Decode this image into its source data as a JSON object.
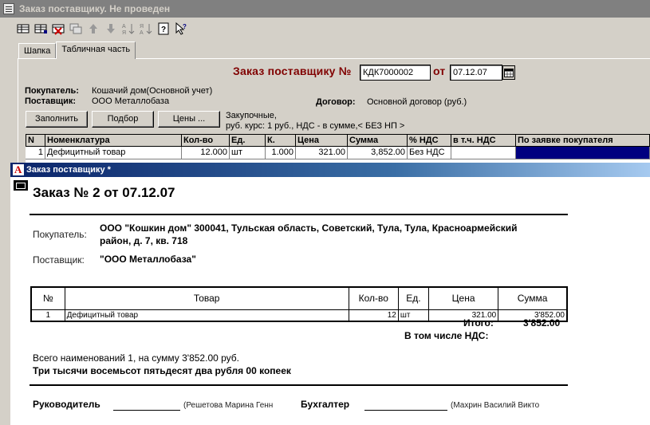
{
  "bg_window": {
    "title": "Заказ поставщику. Не проведен",
    "toolbar_icons": [
      "table-icon",
      "grid-icon",
      "delete-row-icon",
      "copy-row-icon",
      "arrow-up-icon",
      "arrow-down-icon",
      "sort-asc-icon",
      "sort-desc-icon",
      "help-icon",
      "pointer-help-icon"
    ],
    "tabs": [
      "Шапка",
      "Табличная часть"
    ],
    "active_tab": "Табличная часть",
    "heading": "Заказ поставщику №",
    "number": "КДК7000002",
    "date_label": "от",
    "date": "07.12.07",
    "buyer_label": "Покупатель:",
    "buyer_value": "Кошачий дом(Основной учет)",
    "supplier_label": "Поставщик:",
    "supplier_value": "ООО Металлобаза",
    "contract_label": "Договор:",
    "contract_value": "Основной договор (руб.)",
    "btn_fill": "Заполнить",
    "btn_select": "Подбор",
    "btn_prices": "Цены ...",
    "price_info_1": "Закупочные,",
    "price_info_2": "руб. курс: 1 руб., НДС - в сумме,< БЕЗ НП >",
    "grid_headers": [
      "N",
      "Номенклатура",
      "Кол-во",
      "Ед.",
      "К.",
      "Цена",
      "Сумма",
      "% НДС",
      "в т.ч. НДС",
      "По заявке покупателя"
    ],
    "grid_row": [
      "1",
      "Дефицитный товар",
      "12.000",
      "шт",
      "1.000",
      "321.00",
      "3,852.00",
      "Без НДС",
      "",
      ""
    ]
  },
  "fg_window": {
    "title": "Заказ поставщику  *",
    "doc_title": "Заказ № 2 от 07.12.07",
    "buyer_label": "Покупатель:",
    "buyer_line1": "ООО \"Кошкин дом\" 300041, Тульская область, Советский, Тула, Тула, Красноармейский",
    "buyer_line2": "район, д. 7, кв. 718",
    "supplier_label": "Поставщик:",
    "supplier_value": "\"ООО Металлобаза\"",
    "table_headers": [
      "№",
      "Товар",
      "Кол-во",
      "Ед.",
      "Цена",
      "Сумма"
    ],
    "table_row": [
      "1",
      "Дефицитный товар",
      "12",
      "шт",
      "321.00",
      "3'852.00"
    ],
    "total_label": "Итого:",
    "total_value": "3'852.00",
    "vat_label": "В том числе НДС:",
    "count_text": "Всего наименований 1, на сумму 3'852.00 руб.",
    "words_text": "Три тысячи восемьсот пятьдесят два рубля 00 копеек",
    "head_label": "Руководитель",
    "head_name": "(Решетова Марина Генн",
    "accountant_label": "Бухгалтер",
    "accountant_name": "(Махрин Василий Викто"
  },
  "colors": {
    "heading_red": "#800000",
    "grid_selection": "#000080",
    "title_active": "#0a246a",
    "title_inactive": "#808080"
  }
}
